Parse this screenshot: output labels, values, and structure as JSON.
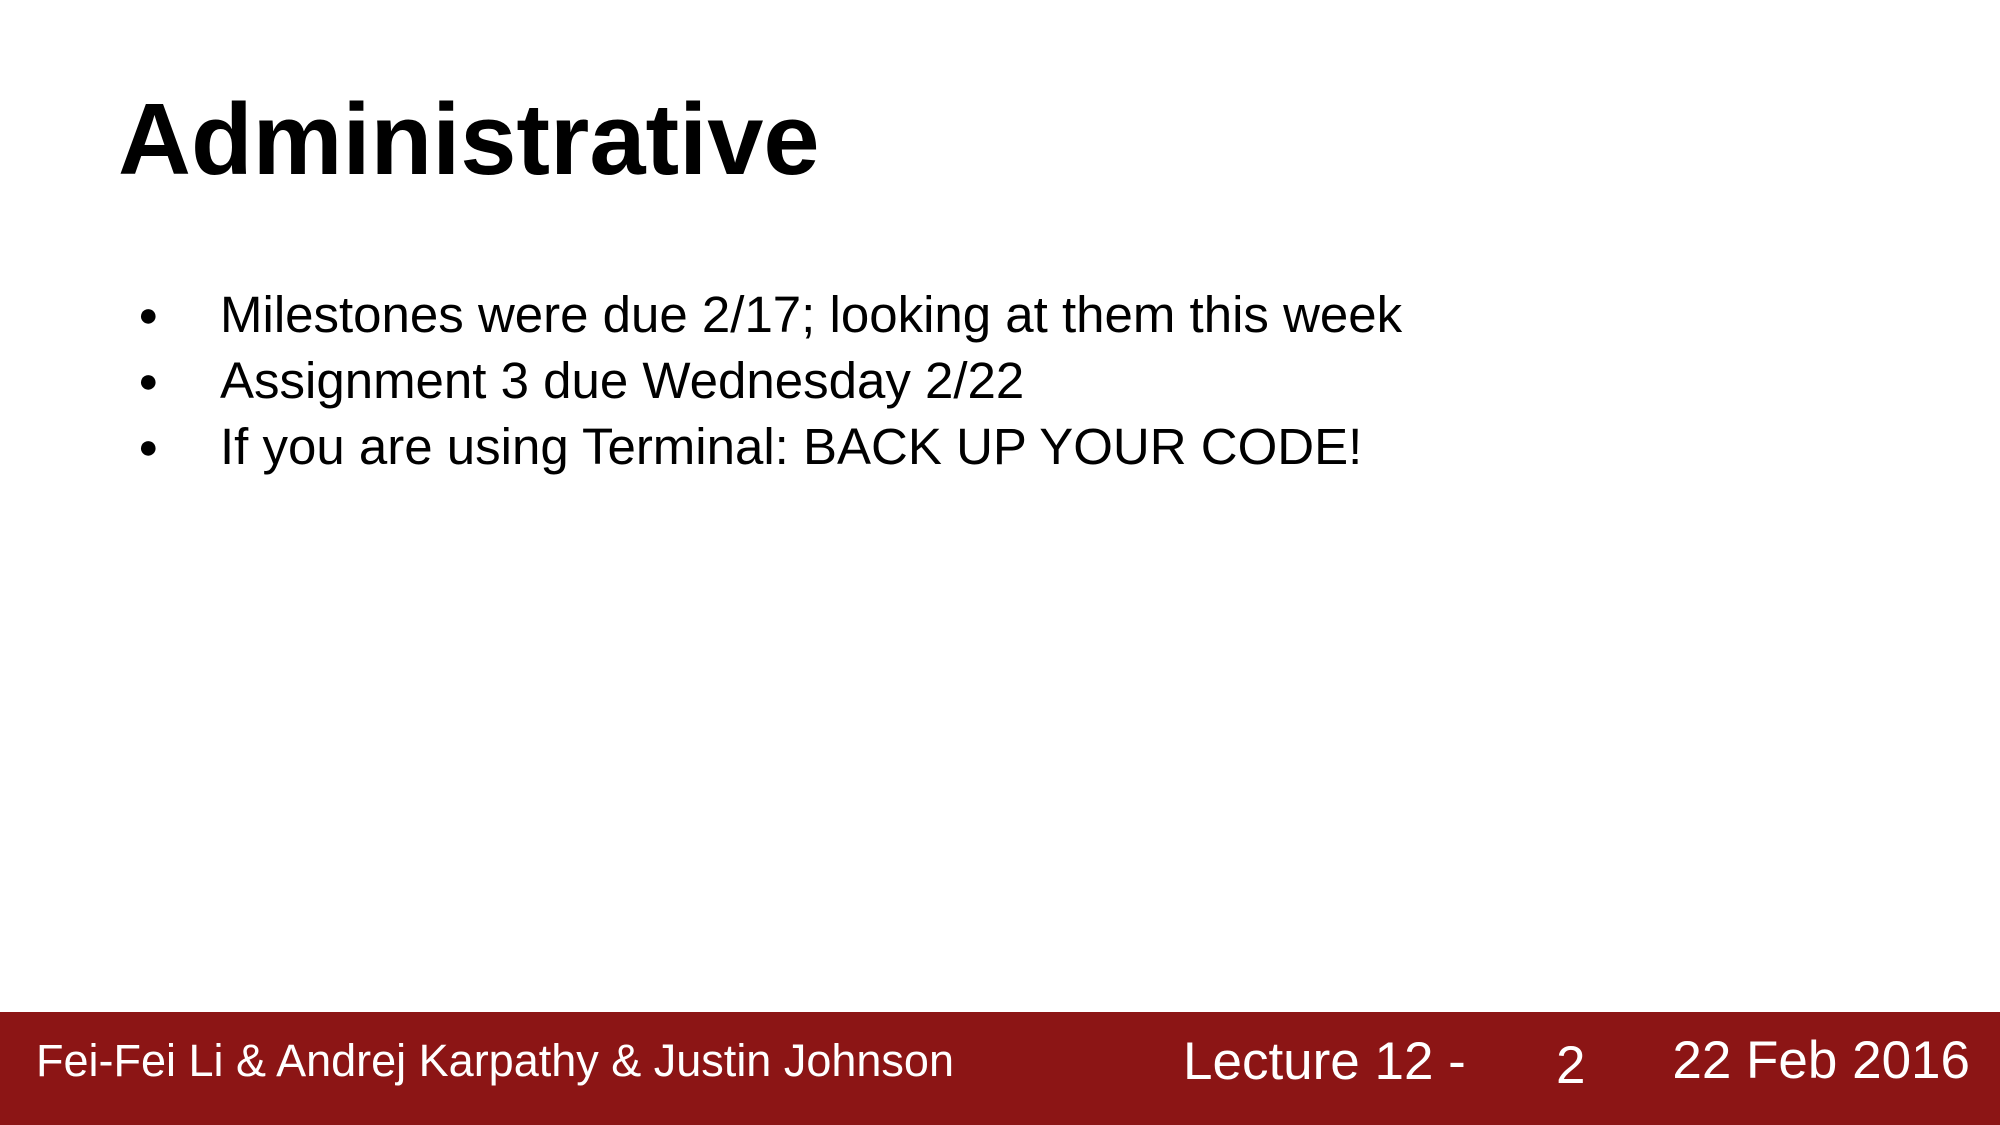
{
  "slide": {
    "title": "Administrative",
    "bullets": [
      {
        "marker": "●",
        "text": "Milestones were due 2/17; looking at them this week"
      },
      {
        "marker": "●",
        "text": "Assignment 3 due Wednesday 2/22"
      },
      {
        "marker": "●",
        "text": "If you are using Terminal: BACK UP YOUR CODE!"
      }
    ]
  },
  "footer": {
    "authors": "Fei-Fei Li & Andrej Karpathy & Justin Johnson",
    "lecture": "Lecture 12 -",
    "page": "2",
    "date": "22 Feb 2016",
    "background_color": "#8c1515",
    "text_color": "#ffffff"
  }
}
